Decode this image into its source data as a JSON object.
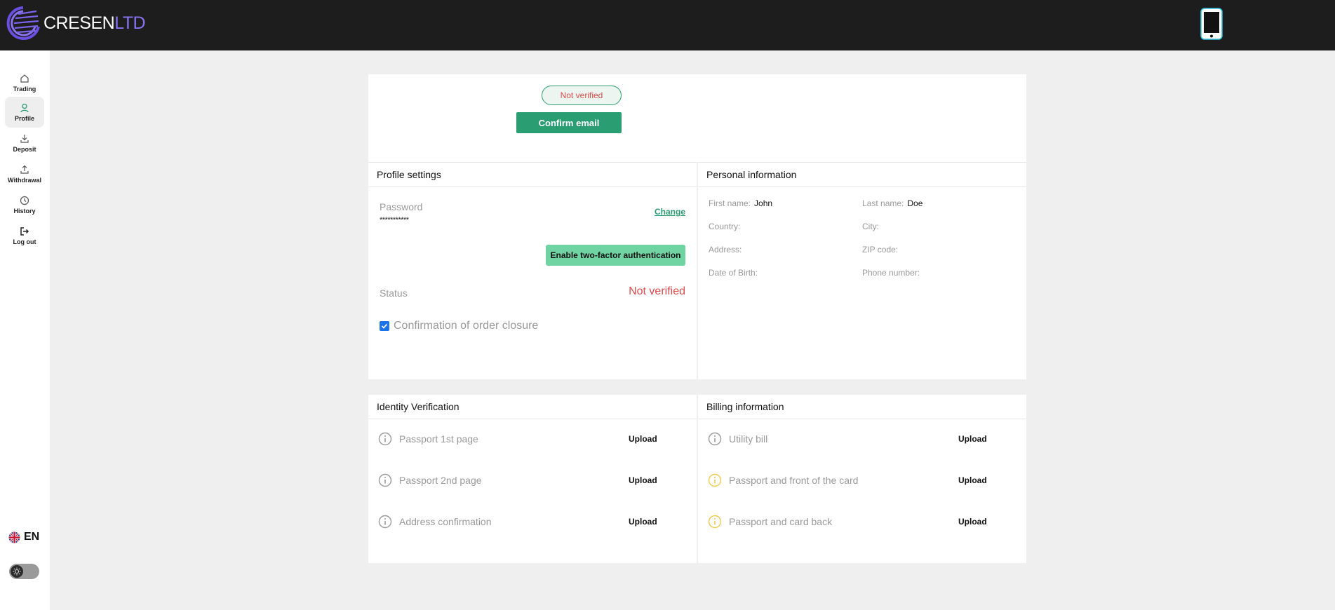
{
  "brand": {
    "name_main": "CRESEN",
    "name_accent": "LTD",
    "accent_color": "#8a73f2",
    "primary_color": "#2a9d72",
    "error_color": "#e24a4a"
  },
  "header": {
    "device_icon": "smartphone-icon"
  },
  "sidebar": {
    "items": [
      {
        "label": "Trading",
        "icon": "home-icon",
        "active": false
      },
      {
        "label": "Profile",
        "icon": "user-icon",
        "active": true
      },
      {
        "label": "Deposit",
        "icon": "download-icon",
        "active": false
      },
      {
        "label": "Withdrawal",
        "icon": "upload-icon",
        "active": false
      },
      {
        "label": "History",
        "icon": "clock-icon",
        "active": false
      },
      {
        "label": "Log out",
        "icon": "logout-icon",
        "active": false
      }
    ],
    "language": {
      "code": "EN",
      "flag": "uk-flag-icon"
    },
    "theme_icon": "sun-icon"
  },
  "email": {
    "status": "Not verified",
    "confirm_label": "Confirm email"
  },
  "profile_settings": {
    "title": "Profile settings",
    "password_label": "Password",
    "password_value": "***********",
    "change_label": "Change",
    "twofa_label": "Enable two-factor authentication",
    "status_label": "Status",
    "status_value": "Not verified",
    "order_closure_label": "Confirmation of order closure",
    "order_closure_checked": true
  },
  "personal_info": {
    "title": "Personal information",
    "fields": [
      {
        "label": "First name:",
        "value": "John"
      },
      {
        "label": "Last name:",
        "value": "Doe"
      },
      {
        "label": "Country:",
        "value": ""
      },
      {
        "label": "City:",
        "value": ""
      },
      {
        "label": "Address:",
        "value": ""
      },
      {
        "label": "ZIP code:",
        "value": ""
      },
      {
        "label": "Date of Birth:",
        "value": ""
      },
      {
        "label": "Phone number:",
        "value": ""
      }
    ]
  },
  "identity_verification": {
    "title": "Identity Verification",
    "items": [
      {
        "label": "Passport 1st page",
        "action": "Upload",
        "icon_color": "#9a9a9a"
      },
      {
        "label": "Passport 2nd page",
        "action": "Upload",
        "icon_color": "#9a9a9a"
      },
      {
        "label": "Address confirmation",
        "action": "Upload",
        "icon_color": "#9a9a9a"
      }
    ]
  },
  "billing_information": {
    "title": "Billing information",
    "items": [
      {
        "label": "Utility bill",
        "action": "Upload",
        "icon_color": "#9a9a9a"
      },
      {
        "label": "Passport and front of the card",
        "action": "Upload",
        "icon_color": "#f2c94c"
      },
      {
        "label": "Passport and card back",
        "action": "Upload",
        "icon_color": "#f2c94c"
      }
    ]
  }
}
